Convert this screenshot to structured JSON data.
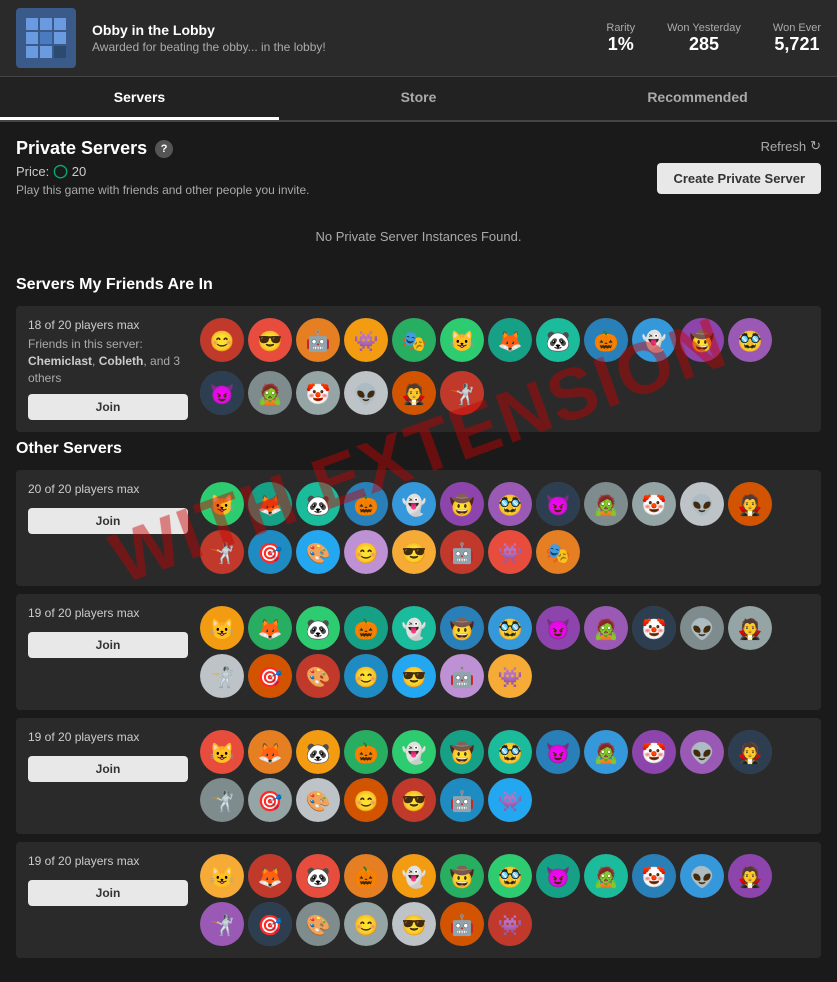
{
  "badge": {
    "title": "Obby in the Lobby",
    "description": "Awarded for beating the obby... in the lobby!",
    "stats": {
      "rarity_label": "Rarity",
      "rarity_value": "1%",
      "won_yesterday_label": "Won Yesterday",
      "won_yesterday_value": "285",
      "won_ever_label": "Won Ever",
      "won_ever_value": "5,721"
    }
  },
  "tabs": [
    {
      "label": "Servers",
      "active": true
    },
    {
      "label": "Store",
      "active": false
    },
    {
      "label": "Recommended",
      "active": false
    }
  ],
  "private_servers": {
    "title": "Private Servers",
    "help_icon": "?",
    "price_label": "Price:",
    "price_value": "20",
    "price_description": "Play this game with friends and other people you invite.",
    "no_instances": "No Private Server Instances Found.",
    "refresh_label": "Refresh",
    "create_btn_label": "Create Private Server"
  },
  "friends_section": {
    "title": "Servers My Friends Are In",
    "server": {
      "players_count": "18 of 20 players max",
      "friends_text": "Friends in this server: Chemiclast, Cobleth, and 3 others",
      "join_label": "Join",
      "avatar_count": 18
    }
  },
  "other_servers": {
    "title": "Other Servers",
    "servers": [
      {
        "players_count": "20 of 20 players max",
        "join_label": "Join",
        "avatar_count": 20
      },
      {
        "players_count": "19 of 20 players max",
        "join_label": "Join",
        "avatar_count": 19
      },
      {
        "players_count": "19 of 20 players max",
        "join_label": "Join",
        "avatar_count": 19
      },
      {
        "players_count": "19 of 20 players max",
        "join_label": "Join",
        "avatar_count": 19
      }
    ]
  },
  "watermark": "WITH\nEXTENSION"
}
